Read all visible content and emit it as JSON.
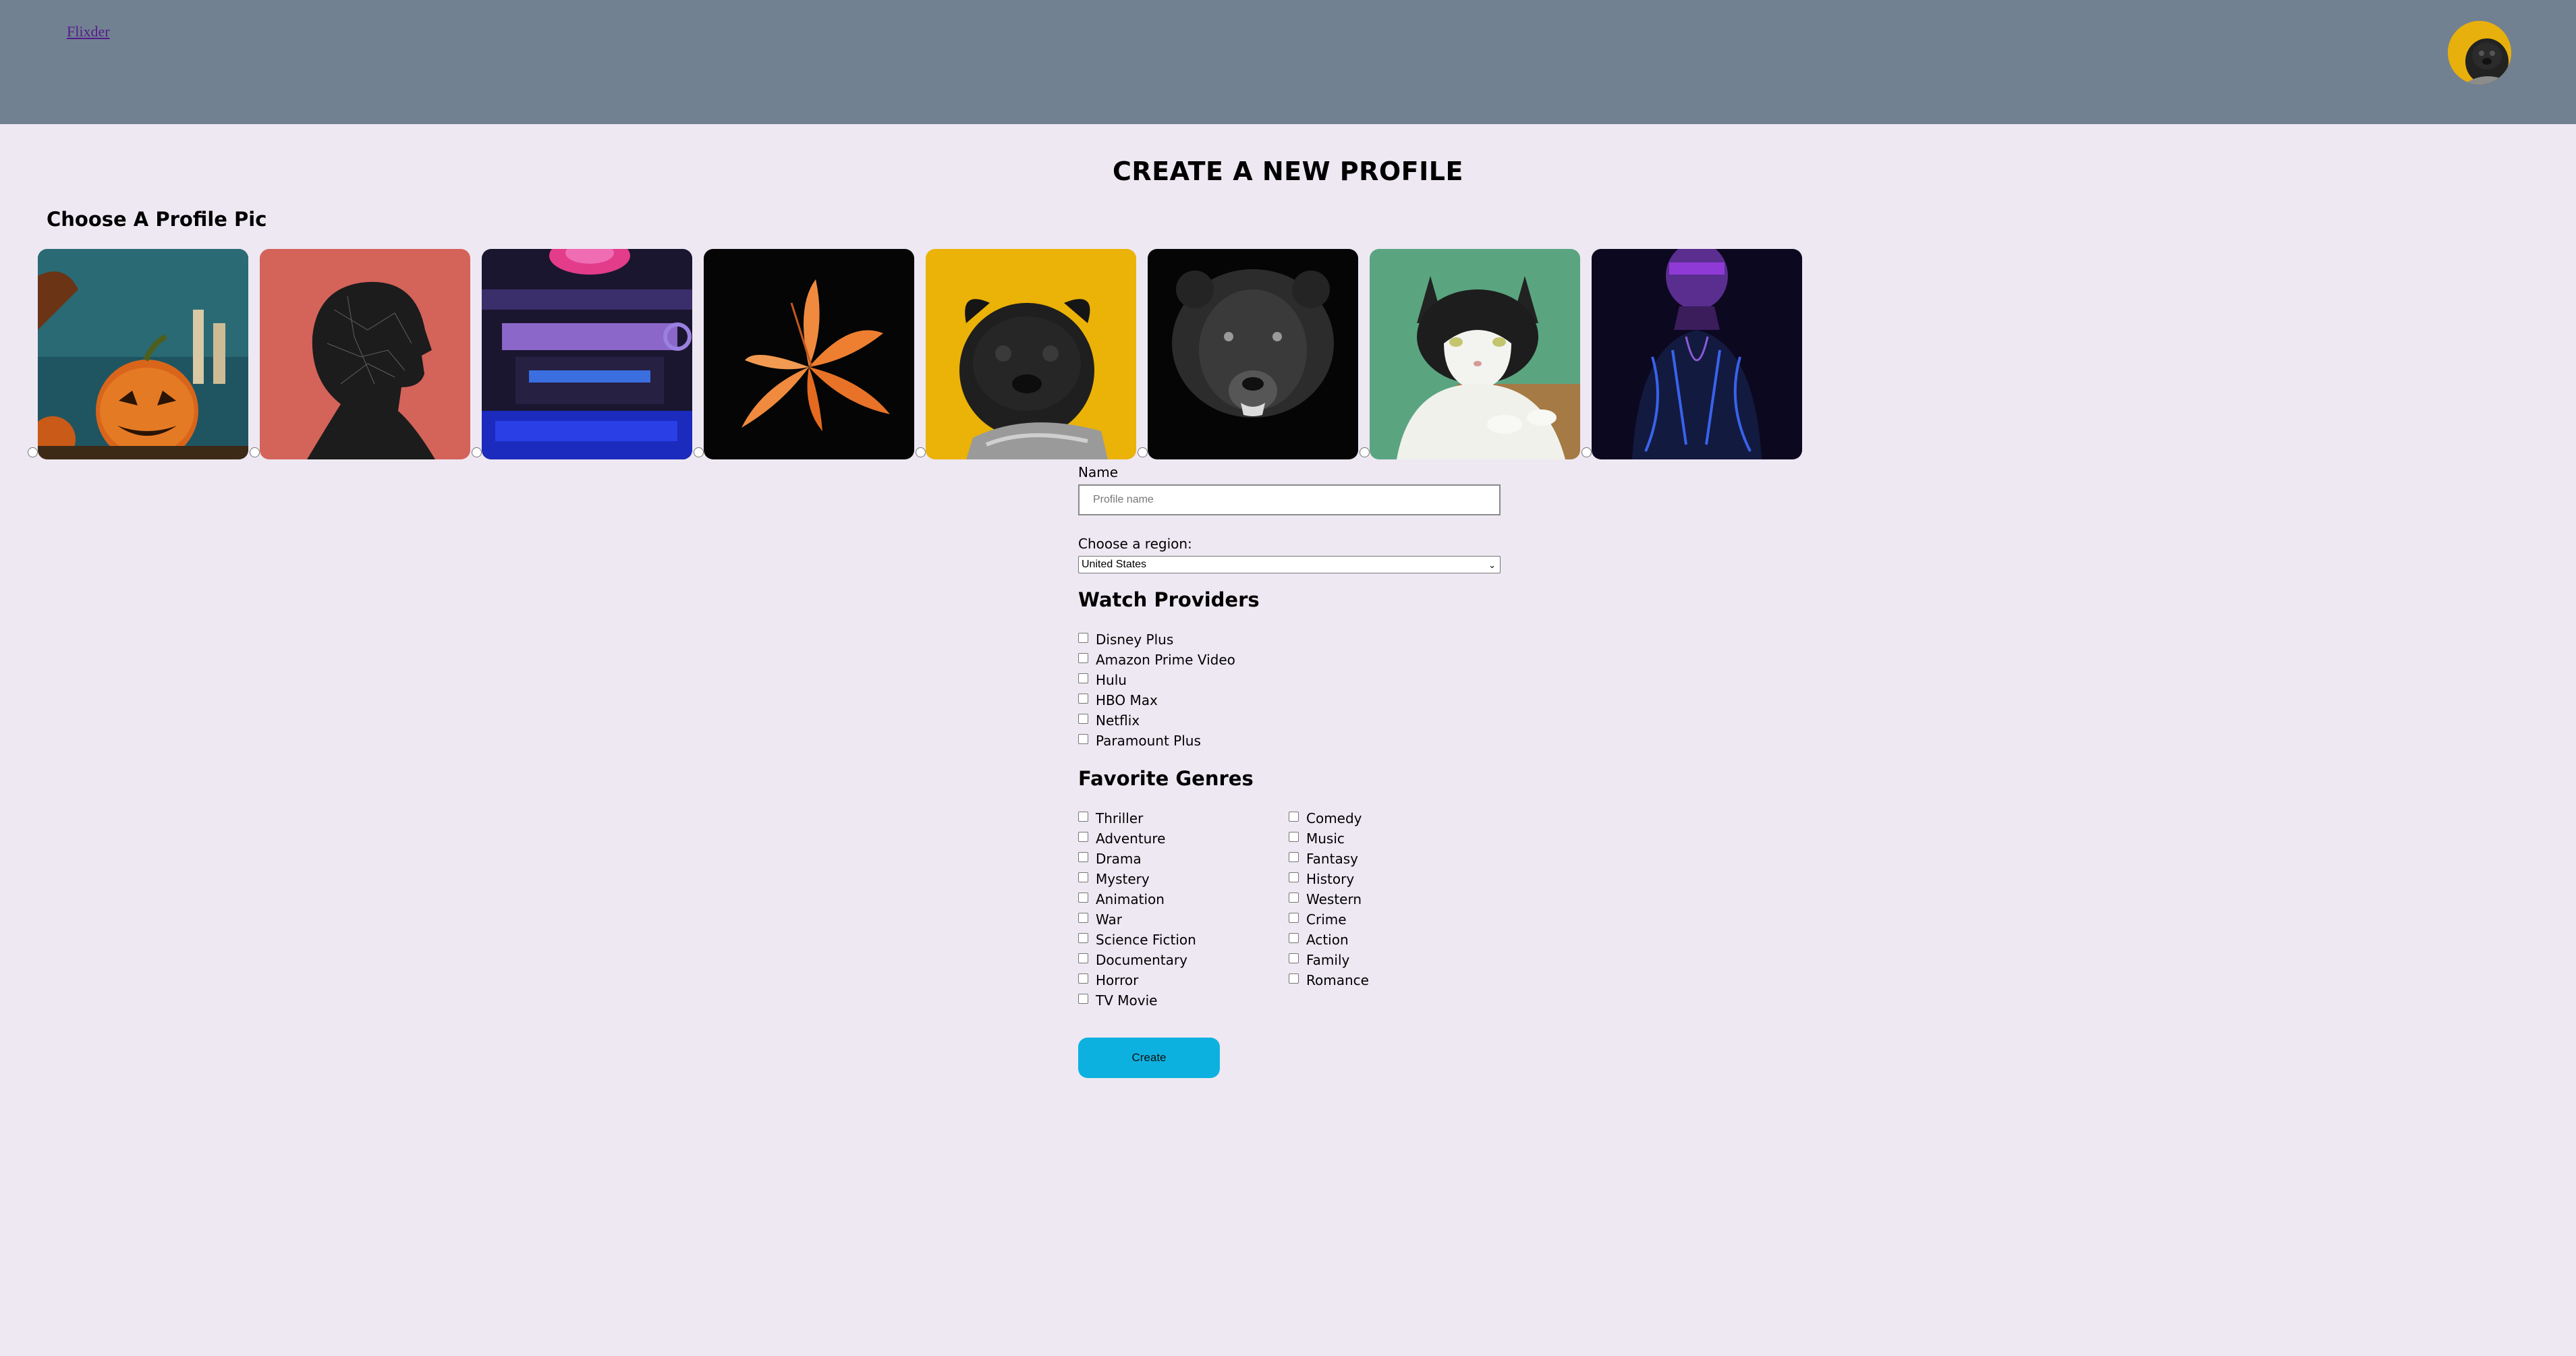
{
  "header": {
    "brand_link": "Flixder",
    "avatar_icon": "pug-avatar-icon",
    "accent_color": "#718191"
  },
  "page": {
    "title": "CREATE A NEW PROFILE"
  },
  "profile_pics": {
    "title": "Choose A Profile Pic",
    "options": [
      {
        "icon": "jack-o-lantern-image"
      },
      {
        "icon": "head-silhouette-image"
      },
      {
        "icon": "pc-hardware-image"
      },
      {
        "icon": "lily-flower-image"
      },
      {
        "icon": "pug-image"
      },
      {
        "icon": "bear-image"
      },
      {
        "icon": "cat-image"
      },
      {
        "icon": "neon-person-image"
      }
    ]
  },
  "form": {
    "name_label": "Name",
    "name_placeholder": "Profile name",
    "name_value": "",
    "region_label": "Choose a region:",
    "region_value": "United States",
    "providers_title": "Watch Providers",
    "providers": [
      "Disney Plus",
      "Amazon Prime Video",
      "Hulu",
      "HBO Max",
      "Netflix",
      "Paramount Plus"
    ],
    "genres_title": "Favorite Genres",
    "genres_col1": [
      "Thriller",
      "Adventure",
      "Drama",
      "Mystery",
      "Animation",
      "War",
      "Science Fiction",
      "Documentary",
      "Horror",
      "TV Movie"
    ],
    "genres_col2": [
      "Comedy",
      "Music",
      "Fantasy",
      "History",
      "Western",
      "Crime",
      "Action",
      "Family",
      "Romance"
    ],
    "create_label": "Create",
    "create_color": "#0db1e0"
  }
}
